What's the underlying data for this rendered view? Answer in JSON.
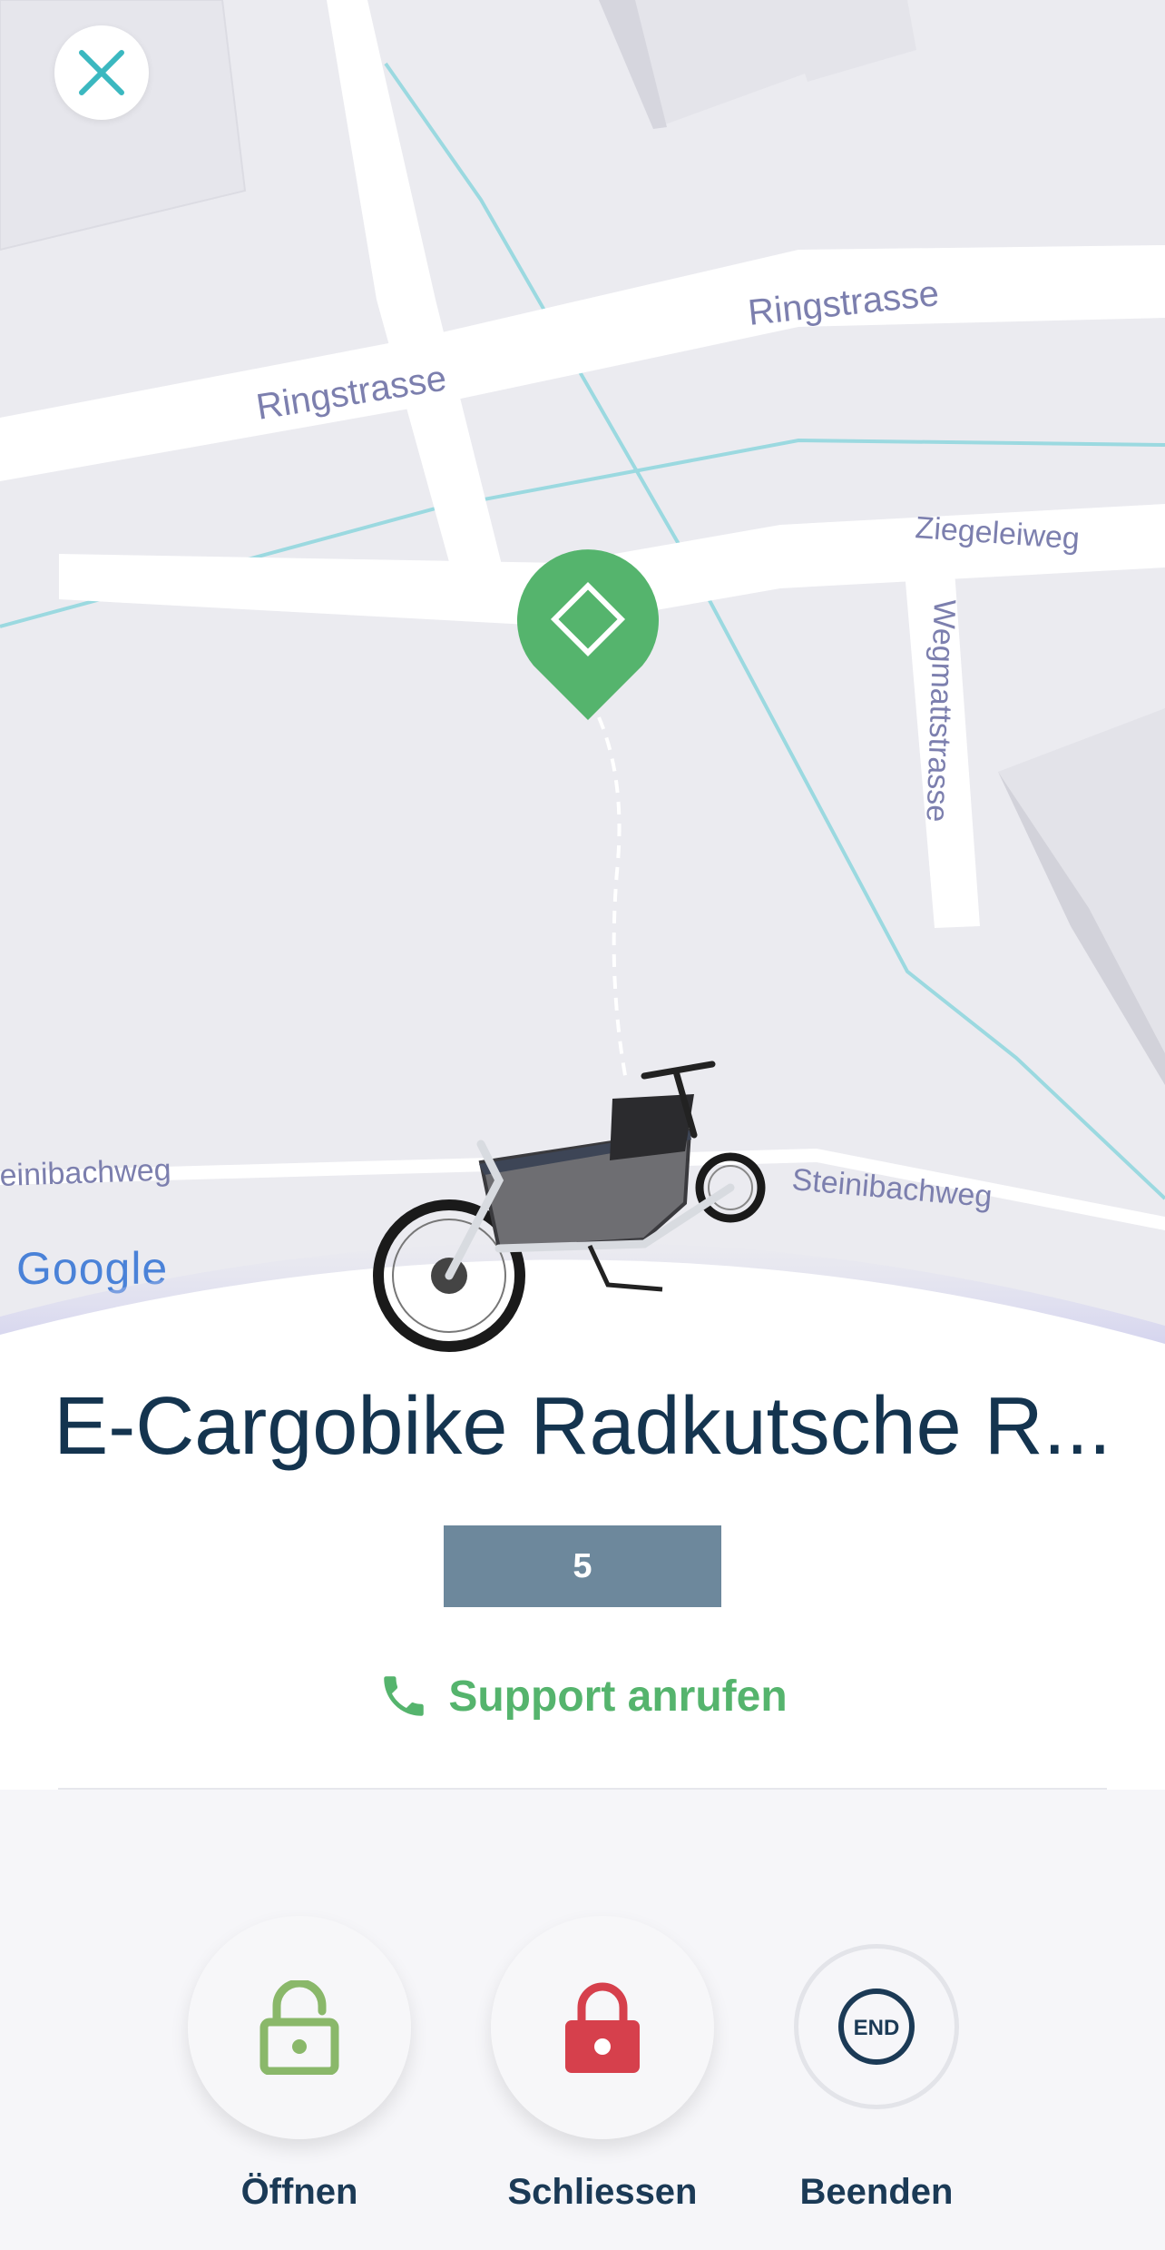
{
  "map": {
    "streets": {
      "ringstrasse_left": "Ringstrasse",
      "ringstrasse_right": "Ringstrasse",
      "ziegeleiweg": "Ziegeleiweg",
      "wegmattstrasse": "Wegmattstrasse",
      "steinibachweg_left": "einibachweg",
      "steinibachweg_right": "Steinibachweg"
    },
    "attribution": "Google",
    "pin_color": "#55b46d"
  },
  "vehicle": {
    "name": "E-Cargobike Radkutsche R...",
    "badge": "5"
  },
  "support": {
    "label": "Support anrufen",
    "icon": "phone-icon"
  },
  "actions": {
    "open": {
      "label": "Öffnen",
      "icon": "unlock-icon",
      "color": "#8ab86a"
    },
    "close": {
      "label": "Schliessen",
      "icon": "lock-icon",
      "color": "#d6404c"
    },
    "end": {
      "label": "Beenden",
      "icon_text": "END",
      "color": "#1b3a56"
    }
  },
  "colors": {
    "accent": "#55b46d",
    "title": "#14344f",
    "badge_bg": "#6d889c",
    "close_icon": "#3bb8c0"
  }
}
